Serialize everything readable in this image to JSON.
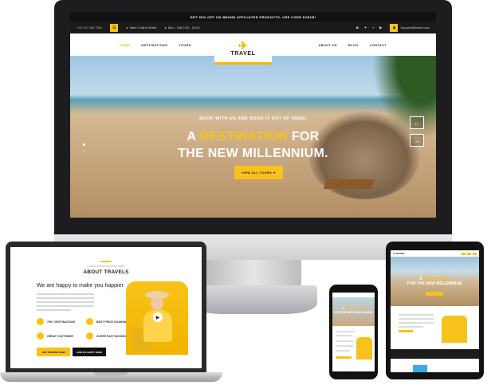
{
  "desktop": {
    "promo_text": "GET 50% OFF ON BRAND AFFILIATED PRODUCTS, USE CODE E1B1B!",
    "phone": "+00 123 456 7890",
    "address": "Main Collins Street",
    "hours": "Mon - Sat 9.00 - 18.00",
    "email": "Support@travel.com",
    "socials": [
      "instagram-icon",
      "twitter-icon",
      "linkedin-icon",
      "youtube-icon"
    ],
    "nav_left": [
      "HOME",
      "DESTINATIONS",
      "TOURS"
    ],
    "nav_right": [
      "ABOUT US",
      "BLOG",
      "CONTACT"
    ],
    "logo_text": "TRAVEL",
    "hero_kicker": "BOOK WITH US AND BOOK IT OUT OF HERE!",
    "hero_title_1": "A ",
    "hero_title_highlight": "DESTINATION",
    "hero_title_2": " FOR",
    "hero_title_3": "THE NEW MILLENNIUM.",
    "hero_button": "VIEW ALL TOURS ➔",
    "arrow_prev": "←",
    "arrow_next": "→"
  },
  "laptop": {
    "kicker": "LOREM IPSUM DOLOR SIT AMET",
    "section_title": "ABOUT TRAVELS",
    "heading": "We are happy to make you happier",
    "features": [
      "70K+ DESTINATIONS",
      "BEST PRICE GUARANTEE",
      "GREAT CUSTOMER",
      "SUPER FAST BOOKING"
    ],
    "button_primary": "GET STARTED NOW",
    "button_secondary": "JOIN AS HAPPY HERE"
  },
  "phone": {
    "hero_title_1": "A ",
    "hero_title_highlight": "DESTINATION",
    "hero_title_2": " FOR THE NEW MILLENNIUM."
  },
  "tablet": {
    "logo_text": "✈ TRAVEL",
    "hero_title_1": "A ",
    "hero_title_highlight": "DESTINATION",
    "hero_title_2": " FOR THE NEW MILLENNIUM."
  },
  "colors": {
    "accent": "#f7c31a",
    "dark": "#111111"
  }
}
